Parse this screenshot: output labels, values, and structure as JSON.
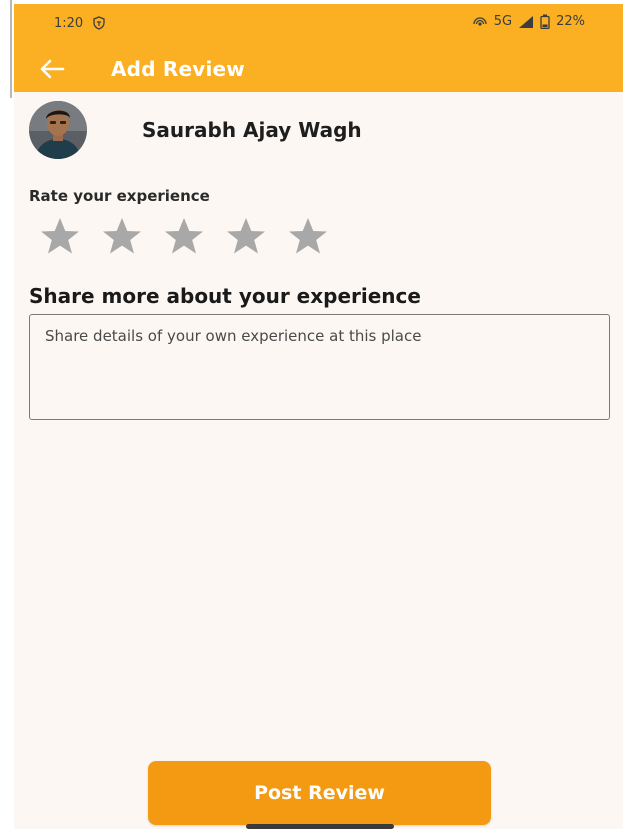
{
  "status_bar": {
    "time": "1:20",
    "network": "5G",
    "battery": "22%"
  },
  "header": {
    "title": "Add Review",
    "back_icon": "back-arrow-icon",
    "background_color": "#fbaf22"
  },
  "user": {
    "name": "Saurabh Ajay Wagh",
    "avatar_icon": "avatar"
  },
  "rating": {
    "label": "Rate your experience",
    "max_stars": 5,
    "selected": 0,
    "star_color": "#a8a8a8"
  },
  "review": {
    "heading": "Share more about your experience",
    "placeholder": "Share details of your own experience at this place",
    "value": ""
  },
  "actions": {
    "post_label": "Post Review",
    "post_color": "#f49a12"
  }
}
